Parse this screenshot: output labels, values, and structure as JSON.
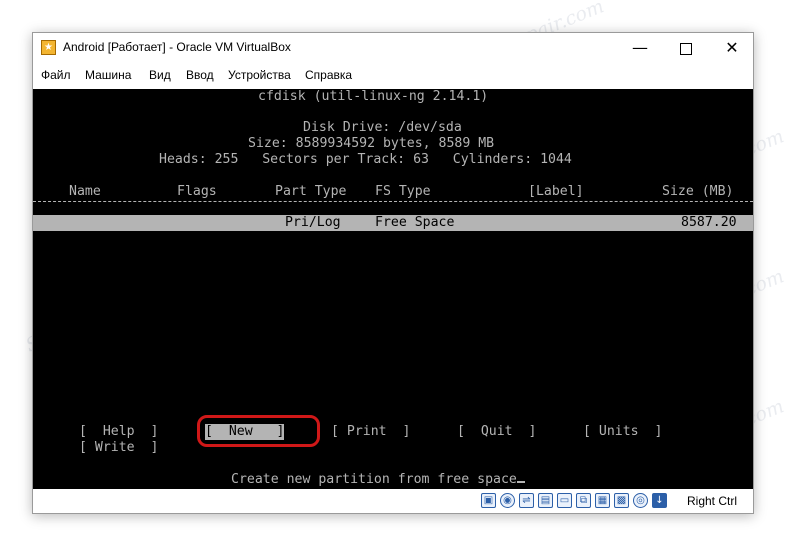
{
  "window": {
    "title": "Android [Работает] - Oracle VM VirtualBox",
    "controls": {
      "minimize": "—",
      "close": "✕"
    }
  },
  "menubar": [
    "Файл",
    "Машина",
    "Вид",
    "Ввод",
    "Устройства",
    "Справка"
  ],
  "screen": {
    "header": "cfdisk (util-linux-ng 2.14.1)",
    "disk_drive": "Disk Drive: /dev/sda",
    "size": "Size: 8589934592 bytes, 8589 MB",
    "geometry": "Heads: 255   Sectors per Track: 63   Cylinders: 1044",
    "columns": {
      "name": "Name",
      "flags": "Flags",
      "part_type": "Part Type",
      "fs_type": "FS Type",
      "label": "[Label]",
      "size": "Size (MB)"
    },
    "selected_row": {
      "part_type": "Pri/Log",
      "fs_type": "Free Space",
      "size": "8587.20"
    },
    "menu_options": {
      "help": "[  Help  ]",
      "new": "[  New   ]",
      "print": "[ Print  ]",
      "quit": "[  Quit  ]",
      "units": "[ Units  ]",
      "write": "[ Write  ]"
    },
    "hint": "Create new partition from free space"
  },
  "statusbar": {
    "host_key": "Right Ctrl"
  },
  "watermark": "Soringpcrepair.com",
  "colors": {
    "terminal_bg": "#000000",
    "terminal_fg": "#b4b4b4",
    "highlight": "#d01818"
  }
}
